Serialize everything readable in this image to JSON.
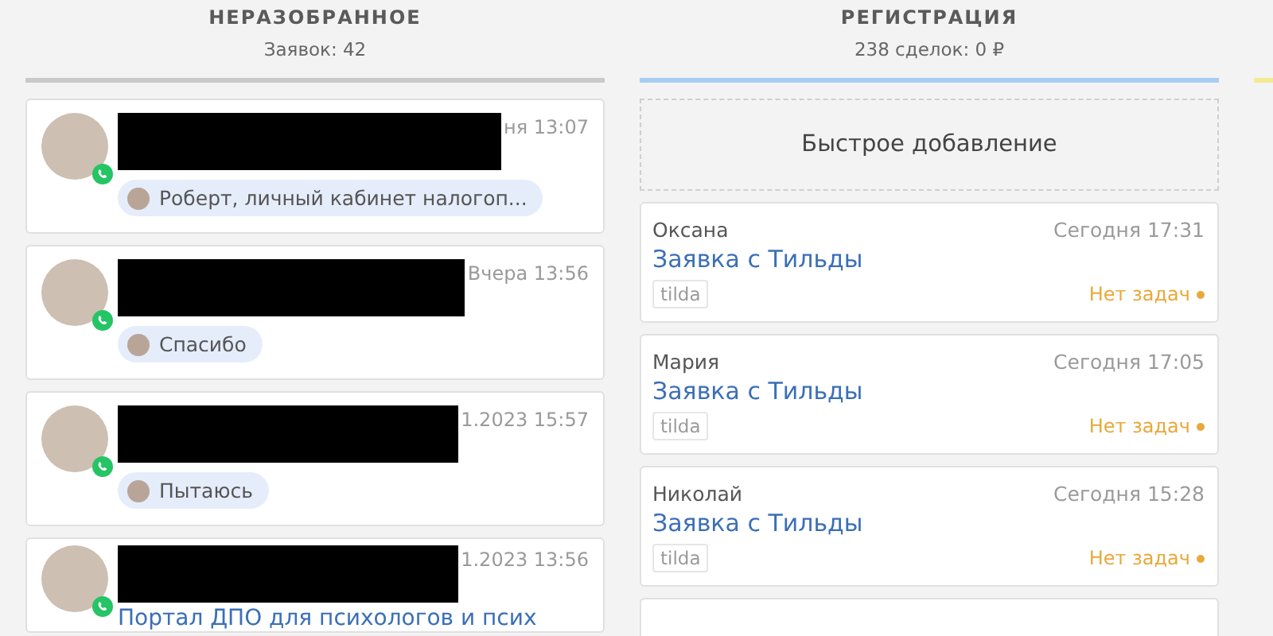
{
  "columns": [
    {
      "title": "НЕРАЗОБРАННОЕ",
      "subtitle": "Заявок: 42",
      "color": "#c9c9c9",
      "kind": "leads",
      "cards": [
        {
          "redacted": true,
          "time": "ня 13:07",
          "kind": "whatsapp",
          "message": "Роберт, личный кабинет налогоп..."
        },
        {
          "redacted": true,
          "time": "Вчера 13:56",
          "kind": "whatsapp",
          "message": "Спасибо"
        },
        {
          "redacted": true,
          "time": "1.2023 15:57",
          "kind": "whatsapp",
          "message": "Пытаюсь"
        },
        {
          "redacted": true,
          "time": "1.2023 13:56",
          "kind": "whatsapp",
          "title": "Портал ДПО для психологов и псих"
        }
      ]
    },
    {
      "title": "РЕГИСТРАЦИЯ",
      "subtitle": "238 сделок: 0 ₽",
      "color": "#a9cdf2",
      "kind": "deals",
      "quick_add": "Быстрое добавление",
      "more_below": true,
      "cards": [
        {
          "name": "Оксана",
          "time": "Сегодня 17:31",
          "title": "Заявка с Тильды",
          "tag": "tilda",
          "tasks": "Нет задач"
        },
        {
          "name": "Мария",
          "time": "Сегодня 17:05",
          "title": "Заявка с Тильды",
          "tag": "tilda",
          "tasks": "Нет задач"
        },
        {
          "name": "Николай",
          "time": "Сегодня 15:28",
          "title": "Заявка с Тильды",
          "tag": "tilda",
          "tasks": "Нет задач"
        }
      ]
    },
    {
      "color": "#f3ea93"
    }
  ]
}
